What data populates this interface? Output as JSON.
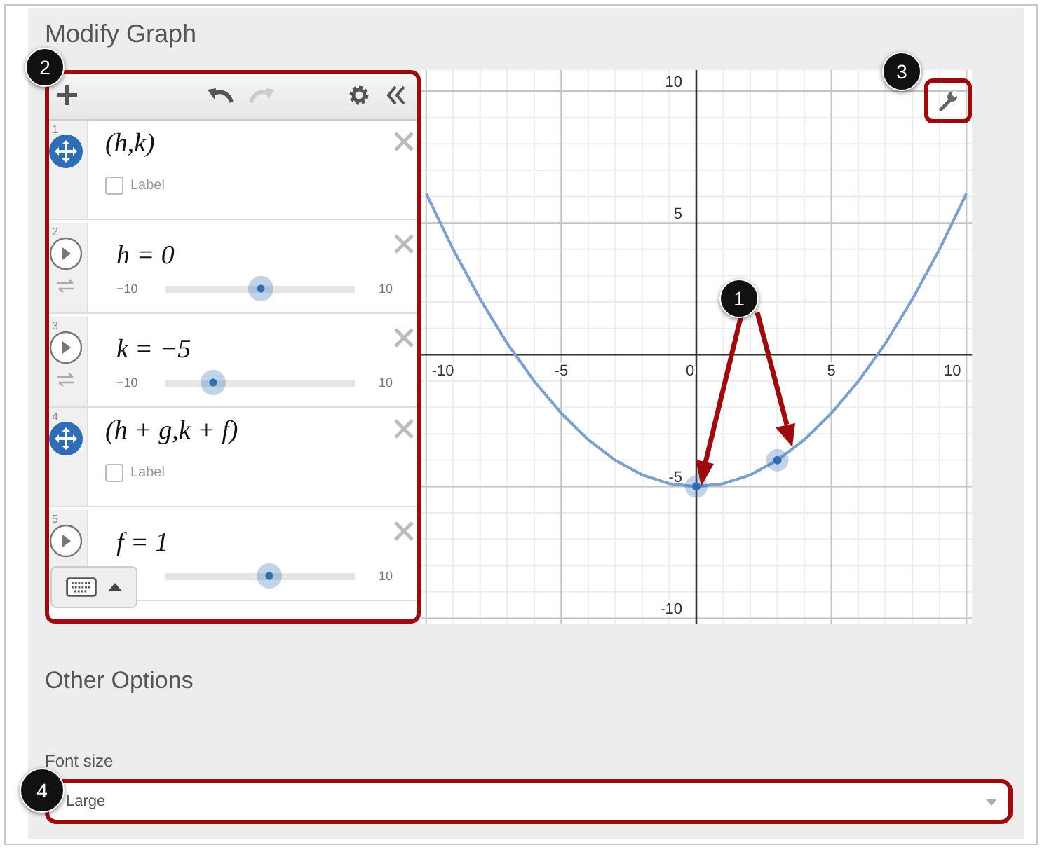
{
  "section_title": "Modify Graph",
  "expressions": [
    {
      "kind": "point",
      "number": "1",
      "formula": "(h,k)",
      "label_checkbox": {
        "text": "Label",
        "checked": false
      }
    },
    {
      "kind": "slider",
      "number": "2",
      "formula": "h = 0",
      "min": "−10",
      "max": "10",
      "level": 0.5
    },
    {
      "kind": "slider",
      "number": "3",
      "formula": "k = −5",
      "min": "−10",
      "max": "10",
      "level": 0.25
    },
    {
      "kind": "point",
      "number": "4",
      "formula": "(h + g,k + f)",
      "label_checkbox": {
        "text": "Label",
        "checked": false
      }
    },
    {
      "kind": "slider",
      "number": "5",
      "formula": "f = 1",
      "max": "10",
      "level": 0.55
    }
  ],
  "graph": {
    "chart_data": {
      "type": "line",
      "x": [
        -10,
        -9,
        -8,
        -7,
        -6,
        -5,
        -4,
        -3,
        -2,
        -1,
        0,
        1,
        2,
        3,
        4,
        5,
        6,
        7,
        8,
        9,
        10
      ],
      "series": [
        {
          "color": "#7a9fd0",
          "values": [
            6.11,
            4,
            2.11,
            0.44,
            -1,
            -2.22,
            -3.22,
            -4,
            -4.56,
            -4.89,
            -5,
            -4.89,
            -4.56,
            -4,
            -3.22,
            -2.22,
            -1,
            0.44,
            2.11,
            4,
            6.11
          ]
        }
      ],
      "xlim": [
        -10.2,
        10.2
      ],
      "ylim": [
        -10.2,
        10.8
      ],
      "xticks": [
        -10,
        -5,
        0,
        5,
        10
      ],
      "yticks": [
        -10,
        -5,
        5,
        10
      ],
      "grid": true
    }
  },
  "callouts": [
    "1",
    "2",
    "3",
    "4"
  ],
  "other_options_title": "Other Options",
  "font_size": {
    "label": "Font size",
    "value": "Large"
  }
}
